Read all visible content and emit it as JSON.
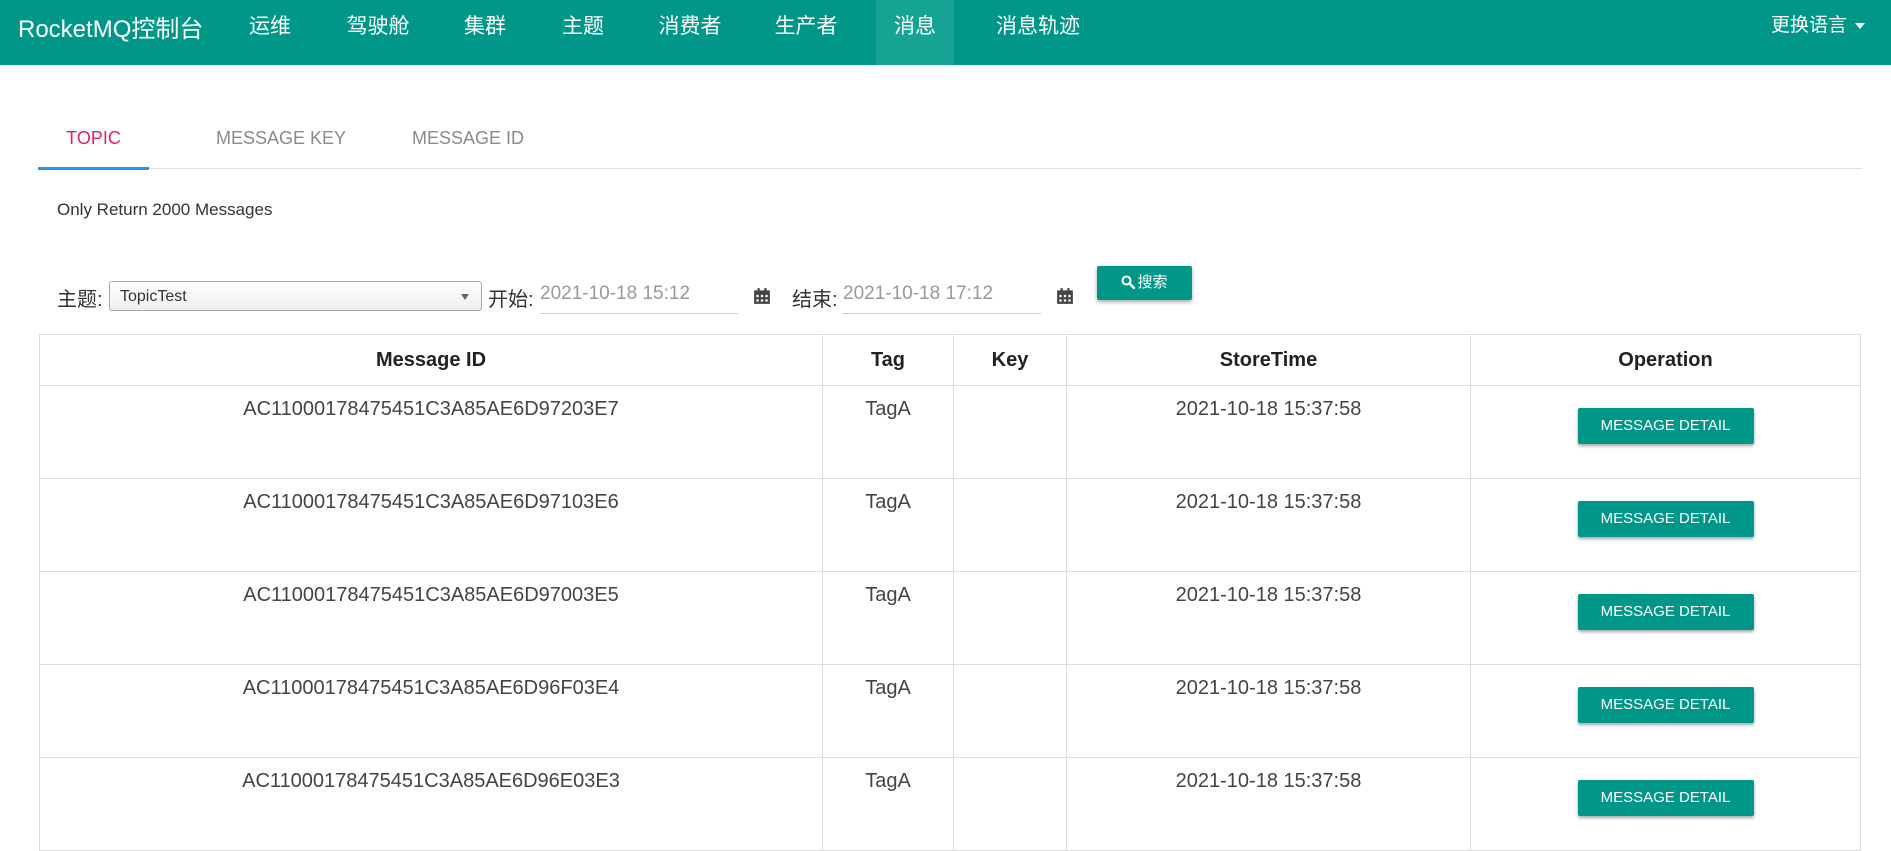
{
  "colors": {
    "primary": "#009688",
    "active_tab": "#e91e63",
    "tab_ink": "#2196f3"
  },
  "navbar": {
    "brand": "RocketMQ控制台",
    "items": [
      "运维",
      "驾驶舱",
      "集群",
      "主题",
      "消费者",
      "生产者",
      "消息",
      "消息轨迹"
    ],
    "active_item": "消息",
    "language": "更换语言"
  },
  "tabs": [
    "TOPIC",
    "MESSAGE KEY",
    "MESSAGE ID"
  ],
  "active_tab": "TOPIC",
  "notice": "Only Return 2000 Messages",
  "search": {
    "topic_label": "主题:",
    "topic_value": "TopicTest",
    "start_label": "开始:",
    "start_value": "2021-10-18 15:12",
    "end_label": "结束:",
    "end_value": "2021-10-18 17:12",
    "search_button": "搜索",
    "search_icon": "search-icon",
    "calendar_icon": "calendar-icon"
  },
  "table": {
    "headers": [
      "Message ID",
      "Tag",
      "Key",
      "StoreTime",
      "Operation"
    ],
    "rows": [
      {
        "message_id": "AC11000178475451C3A85AE6D97203E7",
        "tag": "TagA",
        "key": "",
        "store_time": "2021-10-18 15:37:58",
        "operation": "MESSAGE DETAIL"
      },
      {
        "message_id": "AC11000178475451C3A85AE6D97103E6",
        "tag": "TagA",
        "key": "",
        "store_time": "2021-10-18 15:37:58",
        "operation": "MESSAGE DETAIL"
      },
      {
        "message_id": "AC11000178475451C3A85AE6D97003E5",
        "tag": "TagA",
        "key": "",
        "store_time": "2021-10-18 15:37:58",
        "operation": "MESSAGE DETAIL"
      },
      {
        "message_id": "AC11000178475451C3A85AE6D96F03E4",
        "tag": "TagA",
        "key": "",
        "store_time": "2021-10-18 15:37:58",
        "operation": "MESSAGE DETAIL"
      },
      {
        "message_id": "AC11000178475451C3A85AE6D96E03E3",
        "tag": "TagA",
        "key": "",
        "store_time": "2021-10-18 15:37:58",
        "operation": "MESSAGE DETAIL"
      }
    ]
  }
}
